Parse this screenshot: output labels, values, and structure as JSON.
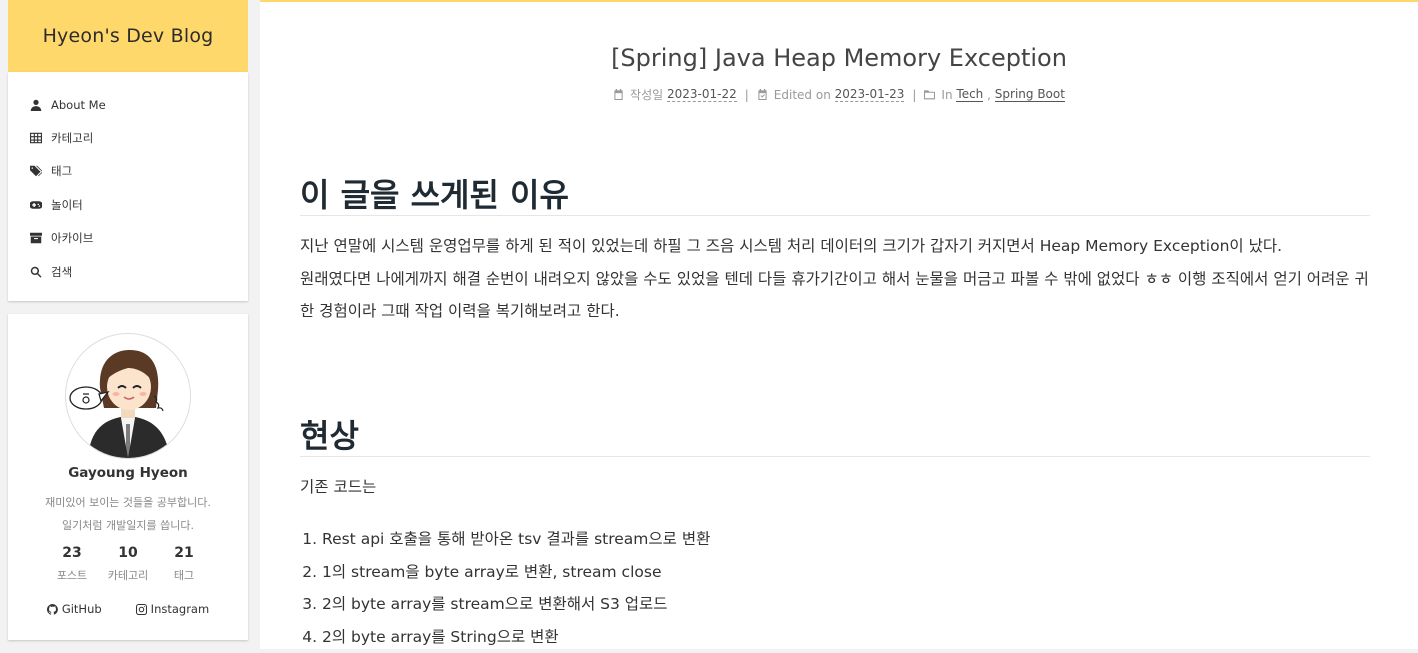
{
  "site": {
    "title": "Hyeon's Dev Blog"
  },
  "menu": [
    {
      "label": "About Me",
      "icon": "user-icon"
    },
    {
      "label": "카테고리",
      "icon": "grid-icon"
    },
    {
      "label": "태그",
      "icon": "tags-icon"
    },
    {
      "label": "놀이터",
      "icon": "gamepad-icon"
    },
    {
      "label": "아카이브",
      "icon": "archive-icon"
    },
    {
      "label": "검색",
      "icon": "search-icon"
    }
  ],
  "profile": {
    "name": "Gayoung Hyeon",
    "desc_line1": "재미있어 보이는 것들을 공부합니다.",
    "desc_line2": "일기처럼 개발일지를 씁니다.",
    "stats": [
      {
        "num": "23",
        "label": "포스트"
      },
      {
        "num": "10",
        "label": "카테고리"
      },
      {
        "num": "21",
        "label": "태그"
      }
    ],
    "socials": [
      {
        "label": "GitHub",
        "icon": "github-icon"
      },
      {
        "label": "Instagram",
        "icon": "instagram-icon"
      }
    ]
  },
  "post": {
    "title": "[Spring] Java Heap Memory Exception",
    "meta": {
      "created_label": "작성일",
      "created_date": "2023-01-22",
      "edited_label": "Edited on",
      "edited_date": "2023-01-23",
      "in_label": "In",
      "category1": "Tech",
      "comma": ",",
      "category2": "Spring Boot",
      "sep": "|"
    },
    "section1": {
      "heading": "이 글을 쓰게된 이유",
      "line1": "지난 연말에 시스템 운영업무를 하게 된 적이 있었는데 하필 그 즈음 시스템 처리 데이터의 크기가 갑자기 커지면서 Heap Memory Exception이 났다.",
      "line2": "원래였다면 나에게까지 해결 순번이 내려오지 않았을 수도 있었을 텐데 다들 휴가기간이고 해서 눈물을 머금고 파볼 수 밖에 없었다 ㅎㅎ 이행 조직에서 얻기 어려운 귀",
      "line3": "한 경험이라 그때 작업 이력을 복기해보려고 한다."
    },
    "section2": {
      "heading": "현상",
      "intro": "기존 코드는",
      "steps": [
        "Rest api 호출을 통해 받아온 tsv 결과를 stream으로 변환",
        "1의 stream을 byte array로 변환, stream close",
        "2의 byte array를 stream으로 변환해서 S3 업로드",
        "2의 byte array를 String으로 변환"
      ]
    }
  },
  "colors": {
    "accent": "#ffd86b",
    "heading": "#1f2a33"
  }
}
